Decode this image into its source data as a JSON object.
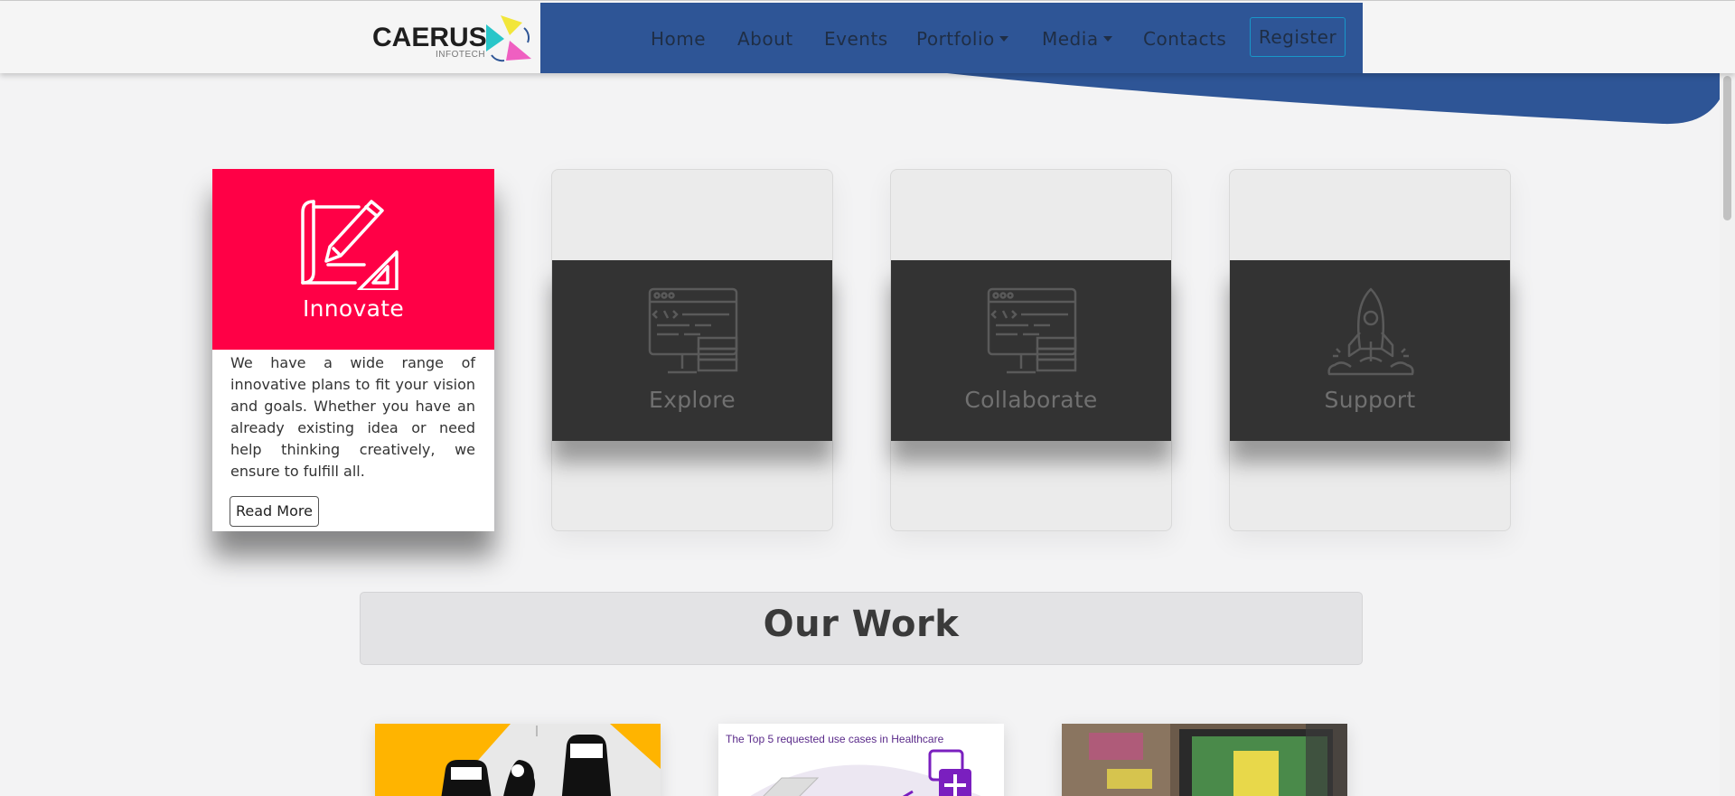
{
  "brand": {
    "name": "CAERUS",
    "sub": "INFOTECH"
  },
  "nav": {
    "items": [
      {
        "label": "Home"
      },
      {
        "label": "About"
      },
      {
        "label": "Events"
      },
      {
        "label": "Portfolio"
      },
      {
        "label": "Media"
      },
      {
        "label": "Contacts"
      }
    ],
    "register": "Register"
  },
  "features": [
    {
      "title": "Innovate",
      "icon": "blueprint-pencil-icon",
      "description": "We have a wide range of innovative plans to fit your vision and goals. Whether you have an already existing idea or need help thinking creatively, we ensure to fulfill all.",
      "button": "Read More",
      "active": true
    },
    {
      "title": "Explore",
      "icon": "code-monitor-icon",
      "active": false
    },
    {
      "title": "Collaborate",
      "icon": "code-monitor-icon",
      "active": false
    },
    {
      "title": "Support",
      "icon": "rocket-icon",
      "active": false
    }
  ],
  "work": {
    "title": "Our Work",
    "items": [
      {
        "image": "cars-illustration"
      },
      {
        "caption": "The Top 5 requested use cases in Healthcare",
        "image": "healthcare-illustration"
      },
      {
        "image": "laptop-desk-photo"
      }
    ]
  },
  "colors": {
    "nav_bg": "#2e5596",
    "accent": "#ff0046",
    "dark_band": "#333333"
  }
}
